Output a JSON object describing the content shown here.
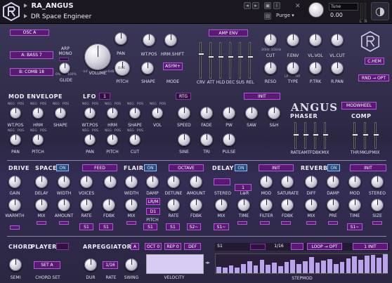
{
  "header": {
    "instrument": "RA_ANGUS",
    "preset": "DR Space Engineer",
    "purge": "Purge",
    "tune_label": "Tune",
    "tune_value": "0.00",
    "left_meter": "L",
    "right_meter": "R",
    "close": "✕"
  },
  "osc": {
    "title": "OSC A",
    "wave1": "A: BASS 7",
    "wave2": "B: COMB 18",
    "arp_mono": "ARP\nMONO",
    "glide_label": "GLIDE",
    "volume_label": "VOLUME",
    "pan_label": "PAN",
    "pitch_label": "PITCH",
    "wtpos_label": "WT.POS",
    "hrmshift_label": "HRM.SHIFT",
    "shape_label": "SHAPE",
    "mode_label": "MODE",
    "mode_value": "ASYM+",
    "pitch_value": "0.00",
    "glide_min": "0%",
    "glide_max": "100%",
    "vol_min": "-inf",
    "vol_max": "+6dB"
  },
  "amp_env": {
    "title": "AMP ENV",
    "labels": [
      "CRV",
      "ATT",
      "HLD",
      "DEC",
      "SUS",
      "REL"
    ],
    "levels": [
      0.7,
      0.62,
      0.62,
      0.62,
      0.62,
      0.62
    ]
  },
  "filter": {
    "cut1": "CUT",
    "fenv": "F.ENV",
    "vlvol": "VL.VOL",
    "vlcut": "VL.CUT",
    "reso": "RESO",
    "type": "TYPE",
    "ptrk": "P.TRK",
    "rpan": "R.PAN",
    "r_min": "20Hz",
    "r_max": "22kHz",
    "neg": "NEG",
    "pos": "POS",
    "lp": "LP",
    "hp": "HP",
    "pct0": "0%",
    "pct100": "100%"
  },
  "chem": {
    "label": "C.HEM",
    "mode": "RND",
    "opt": "→ OPT"
  },
  "mod_env": {
    "title": "MOD ENVELOPE",
    "row1": [
      "WT.POS",
      "HRM",
      "SHAPE"
    ],
    "row2": [
      "PAN",
      "PITCH"
    ]
  },
  "lfo": {
    "title": "LFO",
    "number": "1",
    "sync": "RTG",
    "mode": "INIT",
    "row1": [
      "WT.POS",
      "HRM",
      "SHAPE",
      "VOL"
    ],
    "row2": [
      "PAN",
      "PITCH",
      "CUT"
    ],
    "speed": "SPEED",
    "fade": "FADE",
    "pw": "PW",
    "saw": "SAW",
    "sh": "S&H",
    "sine": "SINE",
    "tri": "TRI",
    "pulse": "PULSE"
  },
  "angus": {
    "logo": "ANGUS",
    "modwheel": "MODWHEEL"
  },
  "phaser": {
    "title": "PHASER",
    "labels": [
      "RATE",
      "AMT",
      "FDBK",
      "MIX"
    ],
    "levels": [
      0.55,
      0.55,
      0.55,
      0.55
    ]
  },
  "comp": {
    "title": "COMP",
    "labels": [
      "THR",
      "MKUP",
      "MIX"
    ],
    "levels": [
      0.55,
      0.55,
      0.55
    ]
  },
  "drive": {
    "title": "DRIVE",
    "gain": "GAIN",
    "warmth": "WARMTH"
  },
  "space": {
    "title": "SPACE",
    "on": "ON",
    "feed": "FEED",
    "delay": "DELAY",
    "width": "WIDTH",
    "voices": "VOICES",
    "mix": "MIX",
    "amount": "AMOUNT",
    "rate": "RATE",
    "fdbk": "FDBK",
    "s1": "S1",
    "s1b": "S1"
  },
  "flair": {
    "title": "FLAIR",
    "on": "ON",
    "octave": "OCTAVE",
    "width": "WIDTH",
    "damp": "DAMP",
    "detune": "DETUNE",
    "amount": "AMOUNT",
    "mix": "MIX",
    "pitch": "PITCH",
    "rate": "RATE",
    "fdbk": "FDBK",
    "s1": "S1",
    "s2": "S2~",
    "d1": "D1",
    "lrm": "LR/M"
  },
  "delay_fx": {
    "title": "DELAY",
    "on": "ON",
    "mode": "INIT",
    "stereo": "STEREO",
    "lr": "L⊕R",
    "mod": "MOD",
    "saturate": "SATURATE",
    "mix": "MIX",
    "time": "TIME",
    "filter": "FILTER",
    "fdbk": "FDBK",
    "s1": "S1~",
    "value": "1"
  },
  "reverb": {
    "title": "REVERB",
    "on": "ON",
    "mode": "INIT",
    "diff": "DIFF",
    "damp": "DAMP",
    "mod": "MOD",
    "stereo": "STEREO",
    "mix": "MIX",
    "pre": "PRE",
    "time": "TIME",
    "size": "SIZE",
    "s1": "S1~"
  },
  "chord": {
    "title": "CHORD",
    "player": "PLAYER",
    "semi": "SEMI",
    "chord_set": "CHORD SET",
    "set_value": "SET A"
  },
  "arp": {
    "title": "ARPEGGIATOR",
    "a": "A",
    "oct": "OCT 0",
    "rep": "REP 0",
    "def": "DEF",
    "dur": "DUR",
    "rate": "RATE",
    "rate_value": "1/16",
    "swing": "SWING",
    "velocity": "VELOCITY",
    "s1": "S1",
    "step": "1/16",
    "loop": "LOOP",
    "opt": "→ OPT",
    "init": "1 INIT",
    "stepmod": "STEPMOD",
    "bars": [
      0.35,
      0.3,
      0.42,
      0.3,
      0.5,
      0.62,
      0.4,
      0.7,
      0.45,
      0.55,
      0.38,
      0.6,
      0.72,
      0.5,
      0.62,
      0.85,
      0.55,
      0.65,
      0.75,
      0.48,
      0.6,
      0.78,
      0.88,
      0.72,
      0.92,
      0.95,
      0.8,
      1.0
    ]
  }
}
